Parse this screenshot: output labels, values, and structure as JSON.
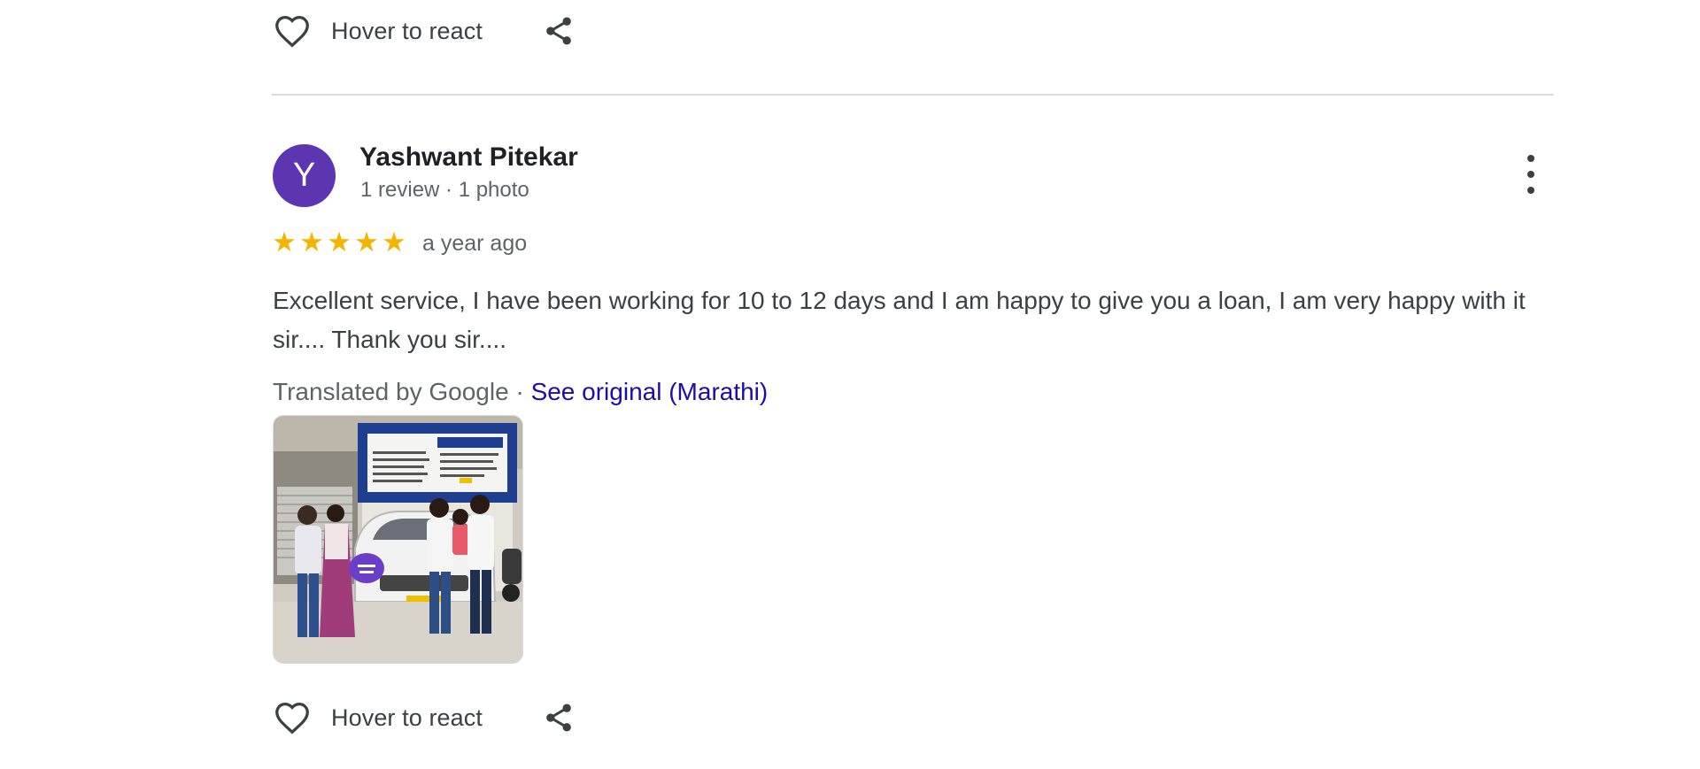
{
  "previous_review": {
    "reaction": {
      "label": "Hover to react",
      "heart_icon": "heart-outline-icon",
      "share_icon": "share-icon"
    }
  },
  "review": {
    "avatar_letter": "Y",
    "avatar_color": "#5e35b1",
    "reviewer_name": "Yashwant Pitekar",
    "reviewer_meta": "1 review · 1 photo",
    "rating": 5,
    "rating_max": 5,
    "star_color": "#f5b400",
    "time": "a year ago",
    "text": "Excellent service, I have been working for 10 to 12 days and I am happy to give you a loan, I am very happy with it sir.... Thank you sir....",
    "translated_by": "Translated by Google",
    "separator": "·",
    "see_original": "See original (Marathi)",
    "link_color": "#1a0dab",
    "more_icon": "more-vertical-icon",
    "photo": {
      "description_icon": "review-photo-image"
    },
    "reaction": {
      "label": "Hover to react",
      "heart_icon": "heart-outline-icon",
      "share_icon": "share-icon"
    }
  }
}
